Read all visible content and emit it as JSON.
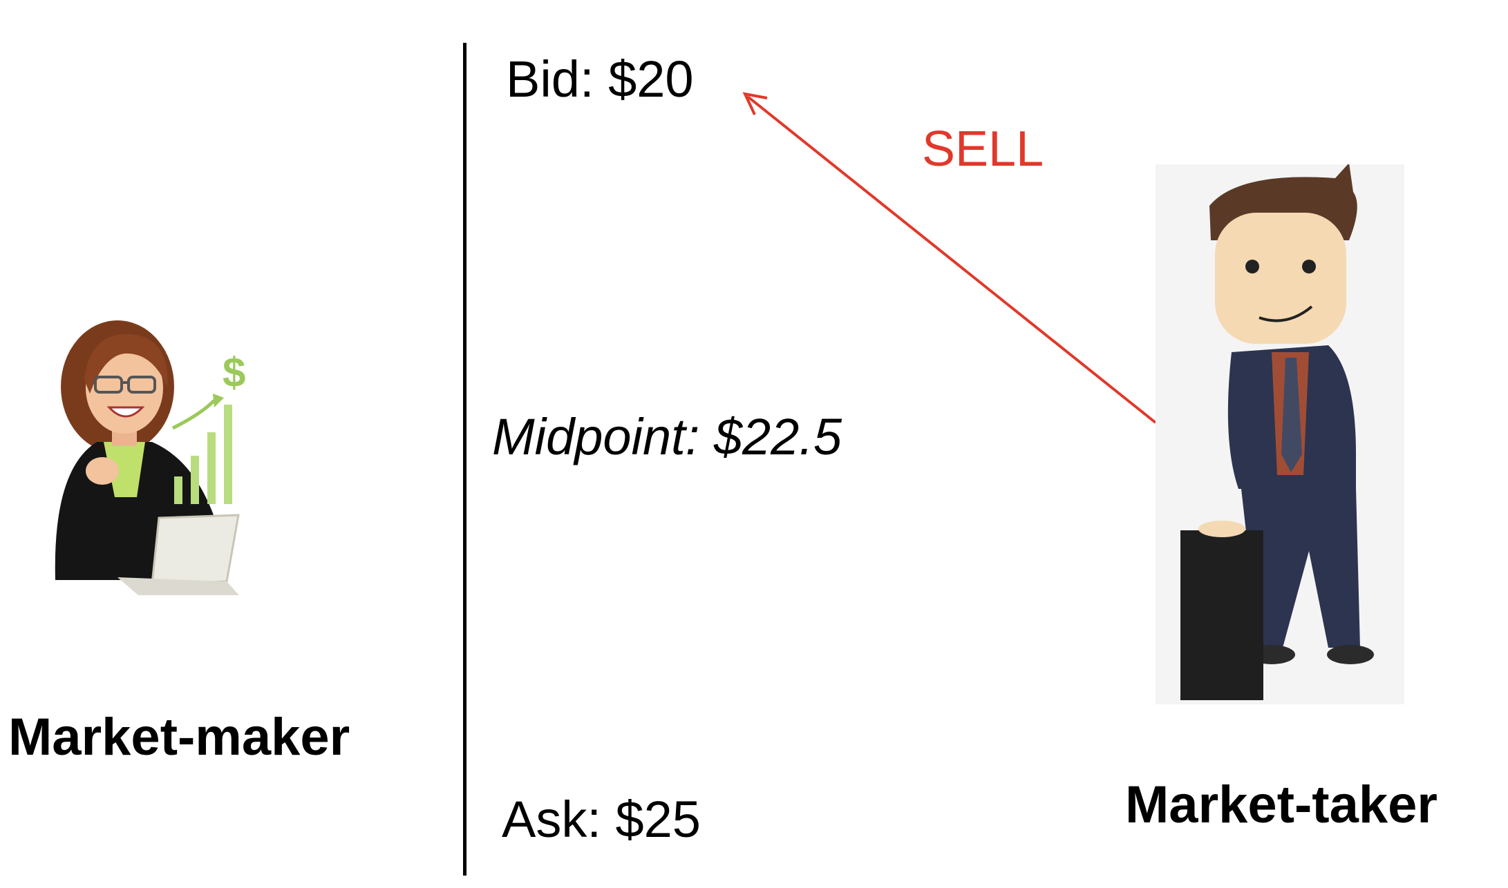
{
  "diagram": {
    "bid_label": "Bid: $20",
    "ask_label": "Ask: $25",
    "midpoint_label": "Midpoint: $22.5",
    "sell_label": "SELL",
    "maker_label": "Market-maker",
    "taker_label": "Market-taker",
    "maker_chart_symbol": "$"
  },
  "colors": {
    "sell_accent": "#e0392b",
    "text": "#000000",
    "chart_green": "#9bc95a",
    "suit_navy": "#2c3450",
    "taker_background": "#f4f4f4"
  },
  "icons": {
    "maker": "businesswoman-with-laptop-icon",
    "taker": "businessman-leaning-icon",
    "growth": "growth-chart-icon"
  }
}
